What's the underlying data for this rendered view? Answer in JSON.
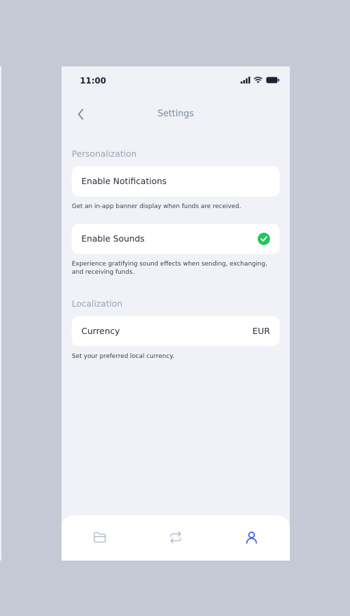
{
  "status_bar": {
    "time": "11:00",
    "icons": [
      "signal-icon",
      "wifi-icon",
      "battery-icon"
    ]
  },
  "header": {
    "title": "Settings",
    "back_icon": "chevron-left-icon"
  },
  "sections": {
    "personalization": {
      "label": "Personalization",
      "notifications": {
        "label": "Enable Notifications",
        "enabled": false,
        "hint": "Get an in-app banner display when funds are received."
      },
      "sounds": {
        "label": "Enable Sounds",
        "enabled": true,
        "hint": "Experience gratifying sound effects when sending, exchanging, and receiving funds."
      }
    },
    "localization": {
      "label": "Localization",
      "currency": {
        "label": "Currency",
        "value": "EUR",
        "hint": "Set your preferred local currency."
      }
    }
  },
  "tabbar": {
    "tabs": [
      {
        "icon": "wallet-icon",
        "active": false
      },
      {
        "icon": "exchange-icon",
        "active": false
      },
      {
        "icon": "profile-icon",
        "active": true
      }
    ]
  },
  "colors": {
    "accent": "#3b5bdb",
    "check": "#22c55e",
    "background": "#f1f2f7",
    "backdrop": "#c4c9d6",
    "inactive_icon": "#b8bfcd"
  }
}
